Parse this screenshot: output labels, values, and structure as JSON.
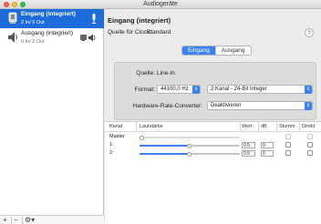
{
  "window": {
    "title": "Audiogeräte"
  },
  "sidebar": {
    "devices": [
      {
        "name": "Eingang (integriert)",
        "io": "2 In/ 0 Out"
      },
      {
        "name": "Ausgang (integriert)",
        "io": "0 In/ 2 Out"
      }
    ],
    "add_label": "+",
    "remove_label": "−",
    "gear_label": "⚙▾"
  },
  "main": {
    "title": "Eingang (integriert)",
    "clock_label": "Quelle für Clock:",
    "clock_value": "Standard",
    "help_label": "?",
    "tabs": [
      {
        "label": "Eingang"
      },
      {
        "label": "Ausgang"
      }
    ],
    "panel": {
      "source_label": "Quelle:",
      "source_value": "Line-In",
      "format_label": "Format:",
      "format_rate": "44100,0 Hz",
      "format_channels": "2 Kanal - 24-Bit Integer",
      "converter_label": "Hardware-Rate-Converter:",
      "converter_value": "Deaktivieren"
    },
    "table": {
      "headers": [
        "Kanal",
        "Lautstärke",
        "Wert",
        "dB",
        "Stumm",
        "Direkt"
      ],
      "rows": [
        {
          "label": "Master",
          "level": 0,
          "value": "",
          "db": ""
        },
        {
          "label": "1:",
          "level": 0.5,
          "value": "0.5",
          "db": "0"
        },
        {
          "label": "2:",
          "level": 0.5,
          "value": "0.5",
          "db": "0"
        }
      ]
    }
  },
  "colors": {
    "accent": "#3b82f0",
    "selection": "#1e6bdc"
  }
}
